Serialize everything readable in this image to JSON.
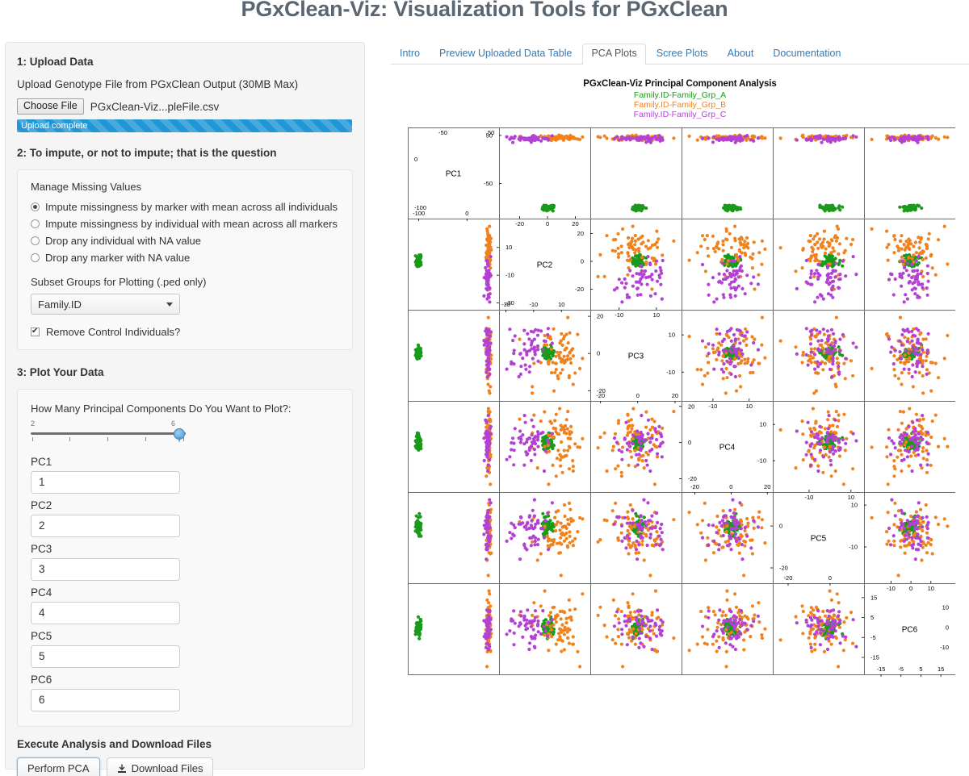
{
  "app": {
    "title": "PGxClean-Viz: Visualization Tools for PGxClean"
  },
  "sidebar": {
    "step1": {
      "heading": "1: Upload Data",
      "upload_label": "Upload Genotype File from PGxClean Output (30MB Max)",
      "choose_file_button": "Choose File",
      "file_name": "PGxClean-Viz...pleFile.csv",
      "progress_text": "Upload complete",
      "progress_percent": 100
    },
    "step2": {
      "heading": "2: To impute, or not to impute; that is the question",
      "group_label": "Manage Missing Values",
      "options": [
        {
          "label": "Impute missingness by marker with mean across all individuals",
          "checked": true
        },
        {
          "label": "Impute missingness by individual with mean across all markers",
          "checked": false
        },
        {
          "label": "Drop any individual with NA value",
          "checked": false
        },
        {
          "label": "Drop any marker with NA value",
          "checked": false
        }
      ],
      "subset_label": "Subset Groups for Plotting (.ped only)",
      "subset_value": "Family.ID",
      "remove_control_label": "Remove Control Individuals?",
      "remove_control_checked": true
    },
    "step3": {
      "heading": "3: Plot Your Data",
      "slider_label": "How Many Principal Components Do You Want to Plot?:",
      "slider_min": "2",
      "slider_max": "6",
      "slider_value": 6,
      "pc_fields": [
        {
          "label": "PC1",
          "value": "1"
        },
        {
          "label": "PC2",
          "value": "2"
        },
        {
          "label": "PC3",
          "value": "3"
        },
        {
          "label": "PC4",
          "value": "4"
        },
        {
          "label": "PC5",
          "value": "5"
        },
        {
          "label": "PC6",
          "value": "6"
        }
      ]
    },
    "step4": {
      "heading": "Execute Analysis and Download Files",
      "perform_pca_button": "Perform PCA",
      "download_files_button": "Download Files",
      "download_icon": "download-icon"
    }
  },
  "main": {
    "tabs": [
      {
        "label": "Intro",
        "active": false
      },
      {
        "label": "Preview Uploaded Data Table",
        "active": false
      },
      {
        "label": "PCA Plots",
        "active": true
      },
      {
        "label": "Scree Plots",
        "active": false
      },
      {
        "label": "About",
        "active": false
      },
      {
        "label": "Documentation",
        "active": false
      }
    ]
  },
  "chart_data": {
    "type": "scatter",
    "title": "PGxClean-Viz Principal Component Analysis",
    "subtitle": "",
    "xlabel": "",
    "ylabel": "",
    "grid": true,
    "legend_position": "top-center",
    "matrix": true,
    "variables": [
      "PC1",
      "PC2",
      "PC3",
      "PC4",
      "PC5",
      "PC6"
    ],
    "axis_ranges": {
      "PC1": [
        -100,
        50
      ],
      "PC2": [
        -30,
        20
      ],
      "PC3": [
        -20,
        20
      ],
      "PC4": [
        -20,
        20
      ],
      "PC5": [
        -20,
        10
      ],
      "PC6": [
        -15,
        15
      ]
    },
    "tick_labels": {
      "PC1": [
        "-100",
        "-50",
        "0",
        "50"
      ],
      "PC2": [
        "-30",
        "-20",
        "-10",
        "0",
        "10",
        "20"
      ],
      "PC3": [
        "-20",
        "-10",
        "0",
        "10",
        "20"
      ],
      "PC4": [
        "-20",
        "-10",
        "0",
        "10",
        "20"
      ],
      "PC5": [
        "-20",
        "-10",
        "0",
        "10"
      ],
      "PC6": [
        "-15",
        "-10",
        "-5",
        "0",
        "5",
        "10",
        "15"
      ]
    },
    "series": [
      {
        "name": "Family.ID-Family_Grp_A",
        "color": "#1a9a1a",
        "n": 60,
        "centroid": {
          "PC1": -100,
          "PC2": 0,
          "PC3": 0,
          "PC4": 0,
          "PC5": 0,
          "PC6": 0
        },
        "spread": {
          "PC1": 3,
          "PC2": 2,
          "PC3": 2,
          "PC4": 2,
          "PC5": 2,
          "PC6": 2
        }
      },
      {
        "name": "Family.ID-Family_Grp_B",
        "color": "#f0821e",
        "n": 70,
        "centroid": {
          "PC1": 45,
          "PC2": 8,
          "PC3": 0,
          "PC4": 0,
          "PC5": -2,
          "PC6": 0
        },
        "spread": {
          "PC1": 3,
          "PC2": 9,
          "PC3": 9,
          "PC4": 9,
          "PC5": 7,
          "PC6": 7
        }
      },
      {
        "name": "Family.ID-Family_Grp_C",
        "color": "#b341d4",
        "n": 55,
        "centroid": {
          "PC1": 43,
          "PC2": -12,
          "PC3": 0,
          "PC4": 0,
          "PC5": -2,
          "PC6": 0
        },
        "spread": {
          "PC1": 3,
          "PC2": 8,
          "PC3": 6,
          "PC4": 6,
          "PC5": 5,
          "PC6": 5
        }
      }
    ],
    "legend_entries": [
      "Family.ID-Family_Grp_A",
      "Family.ID-Family_Grp_B",
      "Family.ID-Family_Grp_C"
    ]
  }
}
